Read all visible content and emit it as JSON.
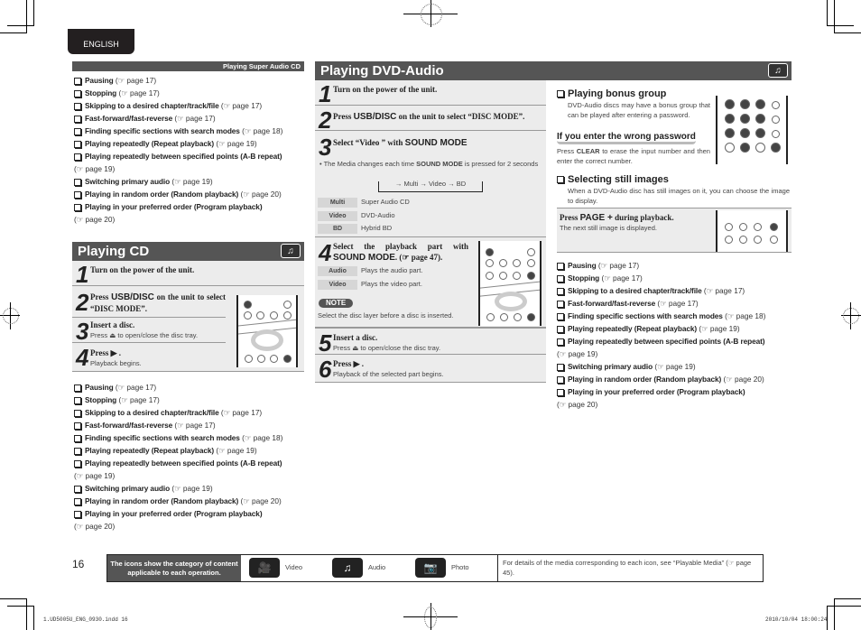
{
  "language_tab": "ENGLISH",
  "sacd_section": {
    "header": "Playing Super Audio CD",
    "items": [
      {
        "label": "Pausing",
        "ref": "page 17"
      },
      {
        "label": "Stopping",
        "ref": "page 17"
      },
      {
        "label": "Skipping to a desired chapter/track/file",
        "ref": "page 17"
      },
      {
        "label": "Fast-forward/fast-reverse",
        "ref": "page 17"
      },
      {
        "label": "Finding specific sections with search modes",
        "ref": "page 18"
      },
      {
        "label": "Playing repeatedly (Repeat playback)",
        "ref": "page 19"
      },
      {
        "label": "Playing repeatedly between specified points (A-B repeat)",
        "ref": "page 19"
      },
      {
        "label": "Switching primary audio",
        "ref": "page 19"
      },
      {
        "label": "Playing in random order (Random playback)",
        "ref": "page 20"
      },
      {
        "label": "Playing in your preferred order (Program playback)",
        "ref": "page 20"
      }
    ]
  },
  "cd_section": {
    "title": "Playing CD",
    "icon": "audio-icon",
    "steps": [
      {
        "num": "1",
        "text": "Turn on the power of the unit.",
        "sub": ""
      },
      {
        "num": "2",
        "pre": "Press ",
        "key": "USB/DISC",
        "post": " on the unit to select “DISC MODE”.",
        "sub": ""
      },
      {
        "num": "3",
        "text": "Insert a disc.",
        "sub": "Press ⏏ to open/close the disc tray."
      },
      {
        "num": "4",
        "text": "Press ▶ .",
        "sub": "Playback begins."
      }
    ],
    "items": [
      {
        "label": "Pausing",
        "ref": "page 17"
      },
      {
        "label": "Stopping",
        "ref": "page 17"
      },
      {
        "label": "Skipping to a desired chapter/track/file",
        "ref": "page 17"
      },
      {
        "label": "Fast-forward/fast-reverse",
        "ref": "page 17"
      },
      {
        "label": "Finding specific sections with search modes",
        "ref": "page 18"
      },
      {
        "label": "Playing repeatedly (Repeat playback)",
        "ref": "page 19"
      },
      {
        "label": "Playing repeatedly between specified points (A-B repeat)",
        "ref": "page 19"
      },
      {
        "label": "Switching primary audio",
        "ref": "page 19"
      },
      {
        "label": "Playing in random order (Random playback)",
        "ref": "page 20"
      },
      {
        "label": "Playing in your preferred order (Program playback)",
        "ref": "page 20"
      }
    ]
  },
  "dvda_section": {
    "title": "Playing DVD-Audio",
    "icon": "audio-icon",
    "step1": {
      "num": "1",
      "text": "Turn on the power of the unit."
    },
    "step2": {
      "num": "2",
      "pre": "Press ",
      "key": "USB/DISC",
      "post": " on the unit to select “DISC MODE”."
    },
    "step3": {
      "num": "3",
      "pre": "Select “Video ” with ",
      "key": "SOUND MODE",
      "bullet_pre": "• The Media changes each time ",
      "bullet_key": "SOUND MODE",
      "bullet_post": " is pressed for 2 seconds",
      "cycle": [
        "Multi",
        "Video",
        "BD"
      ],
      "table": [
        {
          "tag": "Multi",
          "desc": "Super Audio CD"
        },
        {
          "tag": "Video",
          "desc": "DVD-Audio"
        },
        {
          "tag": "BD",
          "desc": "Hybrid BD"
        }
      ]
    },
    "step4": {
      "num": "4",
      "pre": "Select the playback part with ",
      "key": "SOUND MODE",
      "post": ". (☞ page 47).",
      "table": [
        {
          "tag": "Audio",
          "desc": "Plays the audio part."
        },
        {
          "tag": "Video",
          "desc": "Plays the video part."
        }
      ],
      "note_label": "NOTE",
      "note_text": "Select the disc layer before a disc is inserted."
    },
    "step5": {
      "num": "5",
      "text": "Insert a disc.",
      "sub": "Press ⏏ to open/close the disc tray."
    },
    "step6": {
      "num": "6",
      "text": "Press ▶ .",
      "sub": "Playback of the selected part begins."
    },
    "bonus": {
      "title": "Playing bonus group",
      "text": "DVD-Audio discs may have a bonus group that can be played after entering a password.",
      "pw_title": "If you enter the wrong password",
      "pw_pre": "Press ",
      "pw_key": "CLEAR",
      "pw_post": " to erase the input number and then enter the correct number."
    },
    "still": {
      "title": "Selecting still images",
      "text": "When a DVD-Audio disc has still images on it, you can choose the image to display.",
      "step_pre": "Press ",
      "step_key": "PAGE +",
      "step_post": " during playback.",
      "step_sub": "The next still image is displayed."
    },
    "items": [
      {
        "label": "Pausing",
        "ref": "page 17"
      },
      {
        "label": "Stopping",
        "ref": "page 17"
      },
      {
        "label": "Skipping to a desired chapter/track/file",
        "ref": "page 17"
      },
      {
        "label": "Fast-forward/fast-reverse",
        "ref": "page 17"
      },
      {
        "label": "Finding specific sections with search modes",
        "ref": "page 18"
      },
      {
        "label": "Playing repeatedly (Repeat playback)",
        "ref": "page 19"
      },
      {
        "label": "Playing repeatedly between specified points (A-B repeat)",
        "ref": "page 19"
      },
      {
        "label": "Switching primary audio",
        "ref": "page 19"
      },
      {
        "label": "Playing in random order (Random playback)",
        "ref": "page 20"
      },
      {
        "label": "Playing in your preferred order (Program playback)",
        "ref": "page 20"
      }
    ]
  },
  "footer": {
    "page_number": "16",
    "legend_label": "The icons show the category of content applicable to each operation.",
    "icons": [
      {
        "name": "video-icon",
        "label": "Video"
      },
      {
        "name": "audio-icon",
        "label": "Audio"
      },
      {
        "name": "photo-icon",
        "label": "Photo"
      }
    ],
    "note": "For details of the media corresponding to each icon, see “Playable Media” (☞ page 45).",
    "slug_left": "1.UD5005U_ENG_0930.indd   16",
    "slug_right": "2010/10/04   18:00:24"
  },
  "ref_glyph": "☞"
}
